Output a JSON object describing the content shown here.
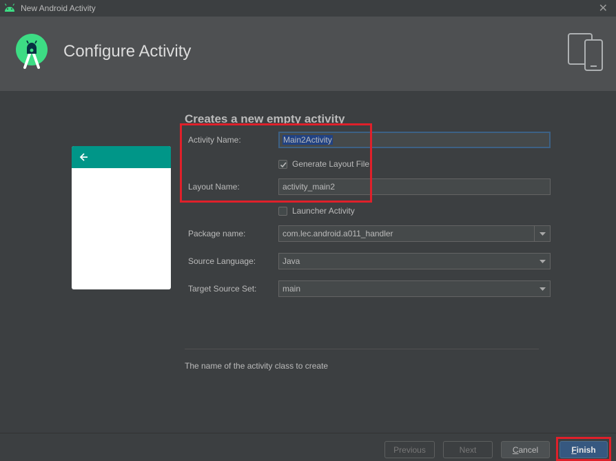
{
  "window": {
    "title": "New Android Activity",
    "close_glyph": "✕"
  },
  "header": {
    "title": "Configure Activity",
    "logo_icon": "android-studio-logo",
    "device_icon": "devices-icon"
  },
  "form": {
    "heading": "Creates a new empty activity",
    "activity_name_label": "Activity Name:",
    "activity_name_value": "Main2Activity",
    "generate_layout_label": "Generate Layout File",
    "generate_layout_checked": true,
    "layout_name_label": "Layout Name:",
    "layout_name_value": "activity_main2",
    "launcher_label": "Launcher Activity",
    "launcher_checked": false,
    "package_label": "Package name:",
    "package_value": "com.lec.android.a011_handler",
    "language_label": "Source Language:",
    "language_value": "Java",
    "source_set_label": "Target Source Set:",
    "source_set_value": "main",
    "description": "The name of the activity class to create"
  },
  "buttons": {
    "previous": "Previous",
    "next": "Next",
    "cancel_first": "C",
    "cancel_rest": "ancel",
    "finish_first": "F",
    "finish_rest": "inish"
  },
  "colors": {
    "accent_teal": "#009688",
    "highlight_red": "#e0202a",
    "default_button": "#365880",
    "android_green": "#3ddc84"
  }
}
